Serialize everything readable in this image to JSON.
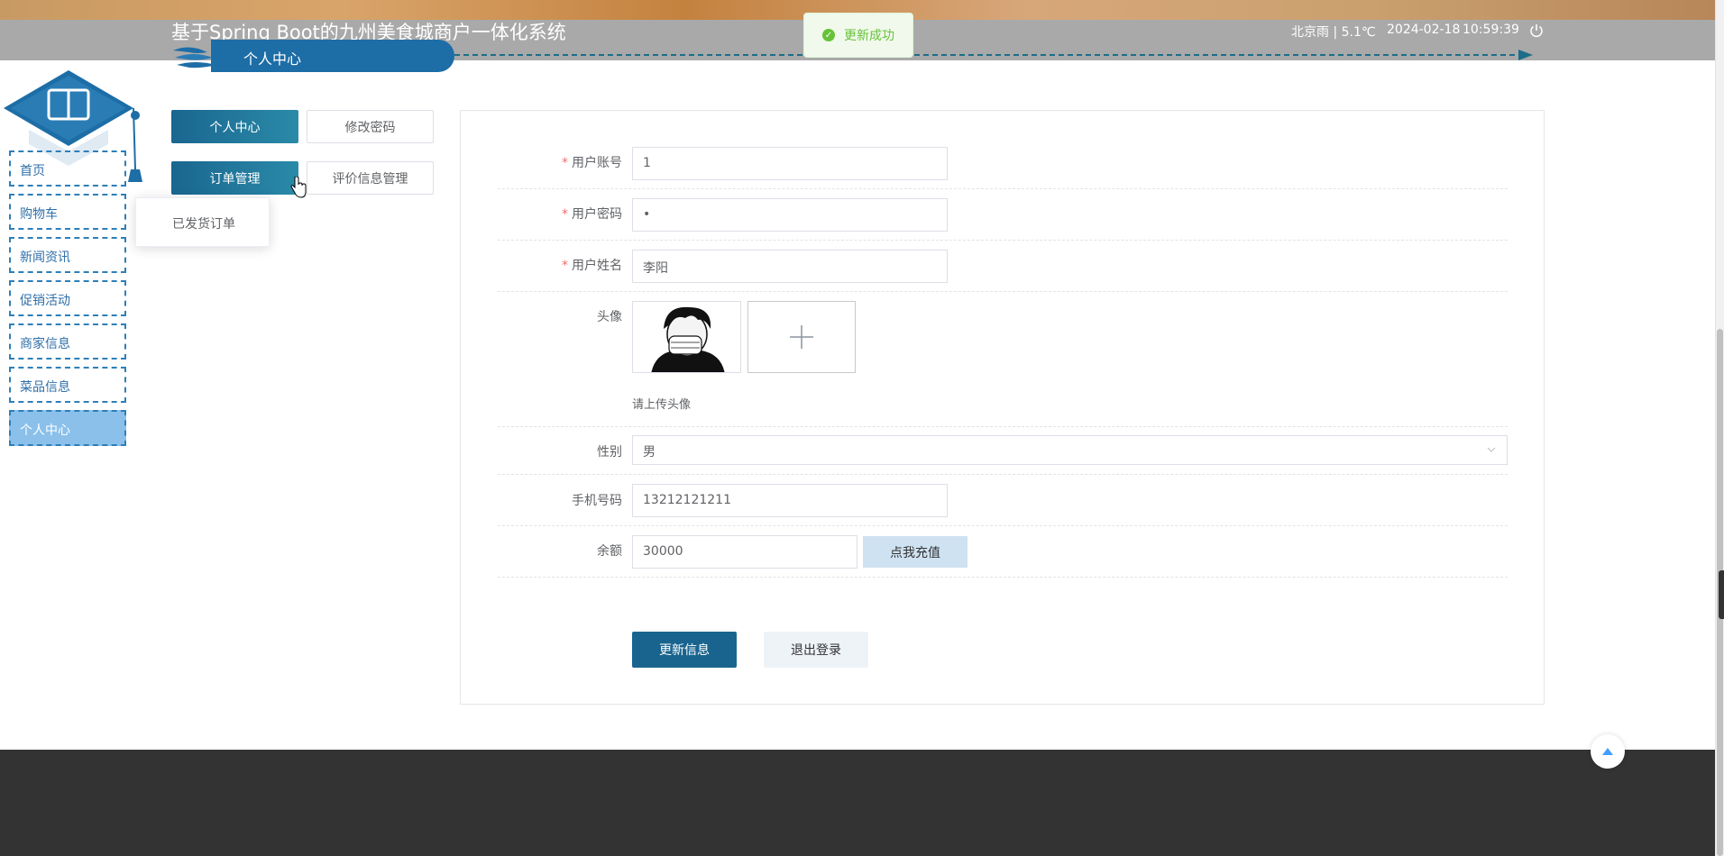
{
  "header": {
    "site_title": "基于Spring Boot的九州美食城商户一体化系统",
    "page_subtitle": "个人中心",
    "weather": "北京雨 | 5.1℃",
    "date": "2024-02-18",
    "time": "10:59:39"
  },
  "toast": {
    "message": "更新成功"
  },
  "nav": {
    "items": [
      {
        "label": "首页"
      },
      {
        "label": "购物车"
      },
      {
        "label": "新闻资讯"
      },
      {
        "label": "促销活动"
      },
      {
        "label": "商家信息"
      },
      {
        "label": "菜品信息"
      },
      {
        "label": "个人中心",
        "active": true
      }
    ]
  },
  "tabs": {
    "personal_center": "个人中心",
    "change_password": "修改密码",
    "order_management": "订单管理",
    "review_management": "评价信息管理",
    "dropdown_item": "已发货订单"
  },
  "form": {
    "account_label": "用户账号",
    "account_value": "1",
    "password_label": "用户密码",
    "password_value": "•",
    "name_label": "用户姓名",
    "name_value": "李阳",
    "avatar_label": "头像",
    "avatar_hint": "请上传头像",
    "gender_label": "性别",
    "gender_value": "男",
    "phone_label": "手机号码",
    "phone_value": "13212121211",
    "balance_label": "余额",
    "balance_value": "30000",
    "recharge_button": "点我充值",
    "required_mark": "*"
  },
  "actions": {
    "update": "更新信息",
    "logout": "退出登录"
  },
  "colors": {
    "primary": "#19648f",
    "nav_border": "#2e7fb8",
    "nav_active": "#8ac0ea",
    "success": "#67c23a",
    "footer": "#333333"
  }
}
